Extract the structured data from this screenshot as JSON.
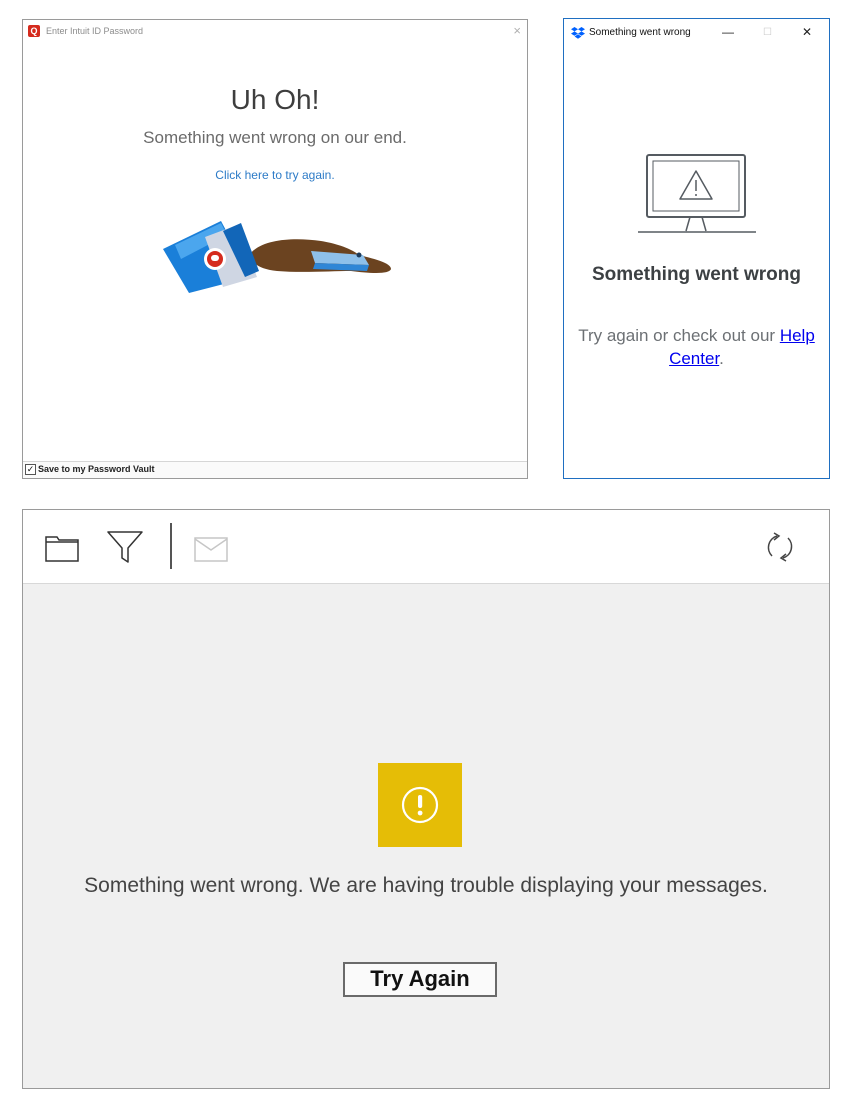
{
  "intuit": {
    "window_title": "Enter Intuit ID Password",
    "app_icon_letter": "Q",
    "close_glyph": "×",
    "heading": "Uh Oh!",
    "subheading": "Something went wrong on our end.",
    "retry_link": "Click here to try again.",
    "checkbox_checked": true,
    "checkbox_mark": "✓",
    "checkbox_label": "Save to my Password Vault",
    "brand_color": "#d52b1e",
    "link_color": "#2d7bc7",
    "illustration_icon": "fallen-coffee-cup-icon"
  },
  "dropbox": {
    "window_title": "Something went wrong",
    "minimize_glyph": "—",
    "maximize_glyph": "☐",
    "close_glyph": "✕",
    "heading": "Something went wrong",
    "sub_prefix": "Try again or check out our",
    "help_link": "Help Center",
    "sub_suffix": ".",
    "brand_color": "#0061fe",
    "illustration_icon": "monitor-warning-icon"
  },
  "mail": {
    "toolbar_icons": [
      "folder-icon",
      "filter-icon",
      "envelope-icon",
      "refresh-icon"
    ],
    "message": "Something went wrong. We are having trouble displaying your messages.",
    "try_again_label": "Try Again",
    "warning_color": "#e5bd06",
    "warning_icon": "exclamation-circle-icon"
  }
}
